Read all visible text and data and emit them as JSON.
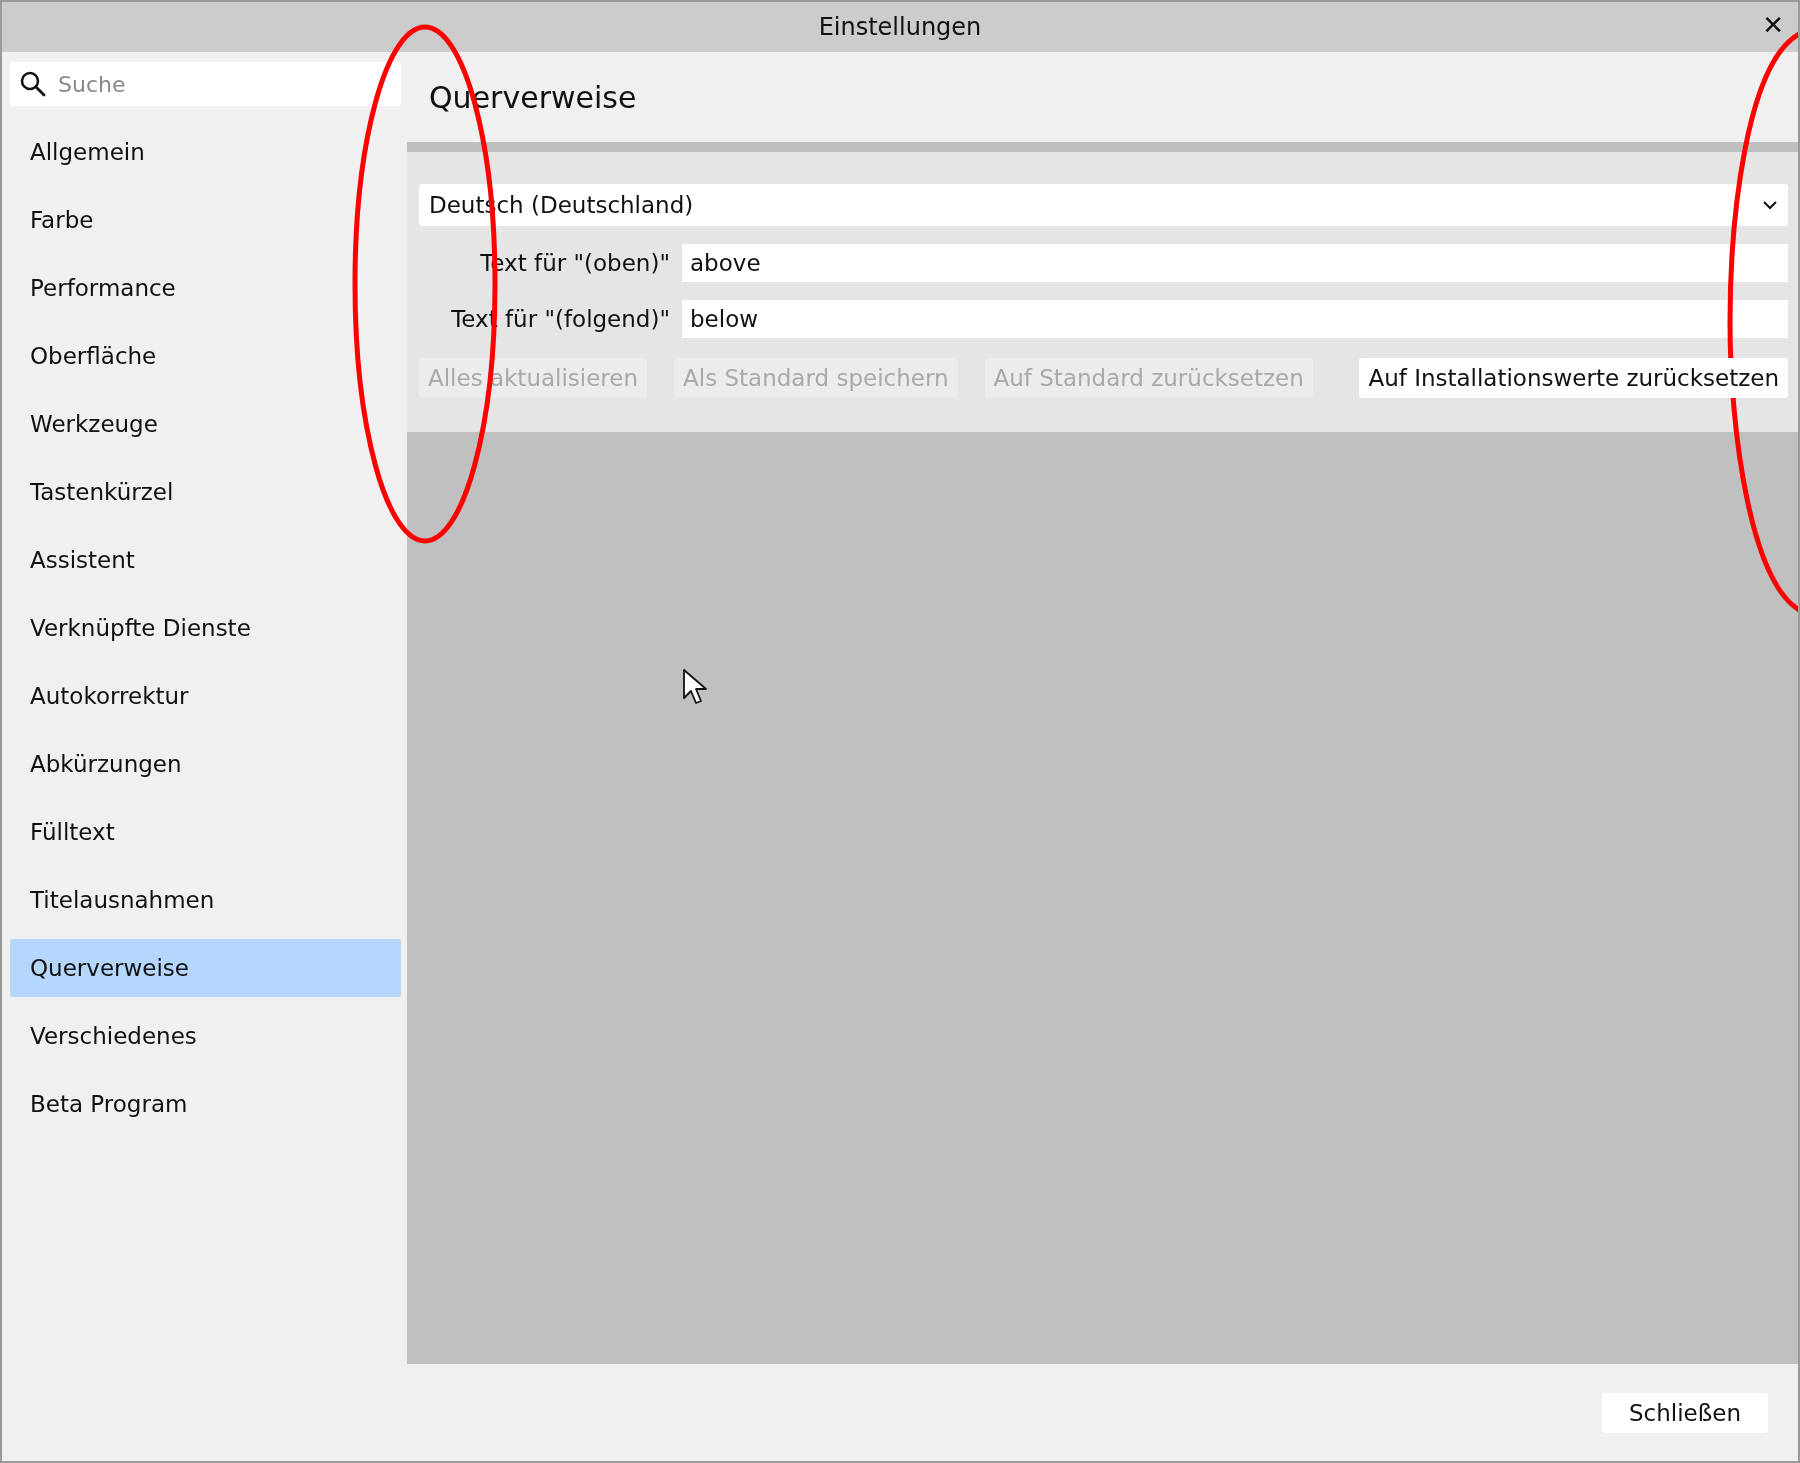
{
  "window": {
    "title": "Einstellungen",
    "close": "✕"
  },
  "sidebar": {
    "search": {
      "placeholder": "Suche"
    },
    "items": [
      {
        "label": "Allgemein",
        "selected": false
      },
      {
        "label": "Farbe",
        "selected": false
      },
      {
        "label": "Performance",
        "selected": false
      },
      {
        "label": "Oberfläche",
        "selected": false
      },
      {
        "label": "Werkzeuge",
        "selected": false
      },
      {
        "label": "Tastenkürzel",
        "selected": false
      },
      {
        "label": "Assistent",
        "selected": false
      },
      {
        "label": "Verknüpfte Dienste",
        "selected": false
      },
      {
        "label": "Autokorrektur",
        "selected": false
      },
      {
        "label": "Abkürzungen",
        "selected": false
      },
      {
        "label": "Fülltext",
        "selected": false
      },
      {
        "label": "Titelausnahmen",
        "selected": false
      },
      {
        "label": "Querverweise",
        "selected": true
      },
      {
        "label": "Verschiedenes",
        "selected": false
      },
      {
        "label": "Beta Program",
        "selected": false
      }
    ]
  },
  "content": {
    "heading": "Querverweise",
    "language": {
      "value": "Deutsch (Deutschland)"
    },
    "fields": [
      {
        "label": "Text für \"(oben)\"",
        "value": "above"
      },
      {
        "label": "Text für \"(folgend)\"",
        "value": "below"
      }
    ],
    "buttons": [
      {
        "label": "Alles aktualisieren",
        "disabled": true
      },
      {
        "label": "Als Standard speichern",
        "disabled": true
      },
      {
        "label": "Auf Standard zurücksetzen",
        "disabled": true
      },
      {
        "label": "Auf Installationswerte zurücksetzen",
        "disabled": false
      }
    ]
  },
  "footer": {
    "close_button": "Schließen"
  }
}
